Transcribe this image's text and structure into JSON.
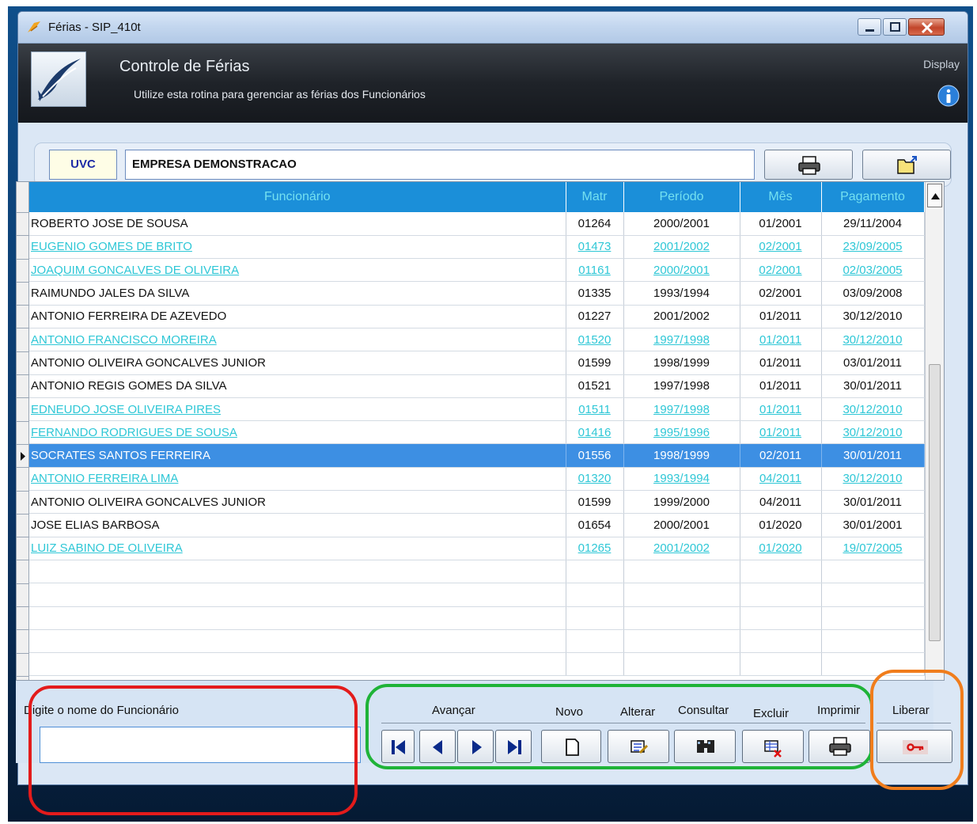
{
  "window": {
    "title": "Férias - SIP_410t"
  },
  "header": {
    "title": "Controle de Férias",
    "subtitle": "Utilize esta rotina para gerenciar as férias dos Funcionários",
    "display_label": "Display"
  },
  "company": {
    "code": "UVC",
    "name": "EMPRESA DEMONSTRACAO"
  },
  "grid": {
    "columns": [
      "Funcionário",
      "Matr",
      "Período",
      "Mês",
      "Pagamento"
    ],
    "rows": [
      {
        "name": "ROBERTO JOSE DE SOUSA",
        "matr": "01264",
        "periodo": "2000/2001",
        "mes": "01/2001",
        "pagamento": "29/11/2004",
        "style": "normal"
      },
      {
        "name": "EUGENIO GOMES DE BRITO",
        "matr": "01473",
        "periodo": "2001/2002",
        "mes": "02/2001",
        "pagamento": "23/09/2005",
        "style": "link"
      },
      {
        "name": "JOAQUIM GONCALVES DE OLIVEIRA",
        "matr": "01161",
        "periodo": "2000/2001",
        "mes": "02/2001",
        "pagamento": "02/03/2005",
        "style": "link"
      },
      {
        "name": "RAIMUNDO JALES DA SILVA",
        "matr": "01335",
        "periodo": "1993/1994",
        "mes": "02/2001",
        "pagamento": "03/09/2008",
        "style": "normal"
      },
      {
        "name": "ANTONIO FERREIRA DE AZEVEDO",
        "matr": "01227",
        "periodo": "2001/2002",
        "mes": "01/2011",
        "pagamento": "30/12/2010",
        "style": "normal"
      },
      {
        "name": "ANTONIO FRANCISCO MOREIRA",
        "matr": "01520",
        "periodo": "1997/1998",
        "mes": "01/2011",
        "pagamento": "30/12/2010",
        "style": "link"
      },
      {
        "name": "ANTONIO OLIVEIRA GONCALVES JUNIOR",
        "matr": "01599",
        "periodo": "1998/1999",
        "mes": "01/2011",
        "pagamento": "03/01/2011",
        "style": "normal"
      },
      {
        "name": "ANTONIO REGIS GOMES DA SILVA",
        "matr": "01521",
        "periodo": "1997/1998",
        "mes": "01/2011",
        "pagamento": "30/01/2011",
        "style": "normal"
      },
      {
        "name": "EDNEUDO JOSE OLIVEIRA PIRES",
        "matr": "01511",
        "periodo": "1997/1998",
        "mes": "01/2011",
        "pagamento": "30/12/2010",
        "style": "link"
      },
      {
        "name": "FERNANDO RODRIGUES DE SOUSA",
        "matr": "01416",
        "periodo": "1995/1996",
        "mes": "01/2011",
        "pagamento": "30/12/2010",
        "style": "link"
      },
      {
        "name": "SOCRATES SANTOS FERREIRA",
        "matr": "01556",
        "periodo": "1998/1999",
        "mes": "02/2011",
        "pagamento": "30/01/2011",
        "style": "selected"
      },
      {
        "name": "ANTONIO FERREIRA LIMA",
        "matr": "01320",
        "periodo": "1993/1994",
        "mes": "04/2011",
        "pagamento": "30/12/2010",
        "style": "link"
      },
      {
        "name": "ANTONIO OLIVEIRA GONCALVES JUNIOR",
        "matr": "01599",
        "periodo": "1999/2000",
        "mes": "04/2011",
        "pagamento": "30/01/2011",
        "style": "normal"
      },
      {
        "name": "JOSE ELIAS BARBOSA",
        "matr": "01654",
        "periodo": "2000/2001",
        "mes": "01/2020",
        "pagamento": "30/01/2001",
        "style": "normal"
      },
      {
        "name": "LUIZ SABINO DE OLIVEIRA",
        "matr": "01265",
        "periodo": "2001/2002",
        "mes": "01/2020",
        "pagamento": "19/07/2005",
        "style": "link"
      }
    ],
    "empty_rows": 5
  },
  "search": {
    "label": "Digite o nome do Funcionário",
    "value": ""
  },
  "toolbar": {
    "avancar_label": "Avançar",
    "novo_label": "Novo",
    "alterar_label": "Alterar",
    "consultar_label": "Consultar",
    "excluir_label": "Excluir",
    "imprimir_label": "Imprimir",
    "liberar_label": "Liberar"
  },
  "colors": {
    "header_bg": "#1b8fd9",
    "header_text": "#74e0f0",
    "link_text": "#2ec7d6",
    "selected_row": "#3d8fe3",
    "annotation_red": "#e31b1b",
    "annotation_green": "#1fb338",
    "annotation_orange": "#f07d1c"
  }
}
